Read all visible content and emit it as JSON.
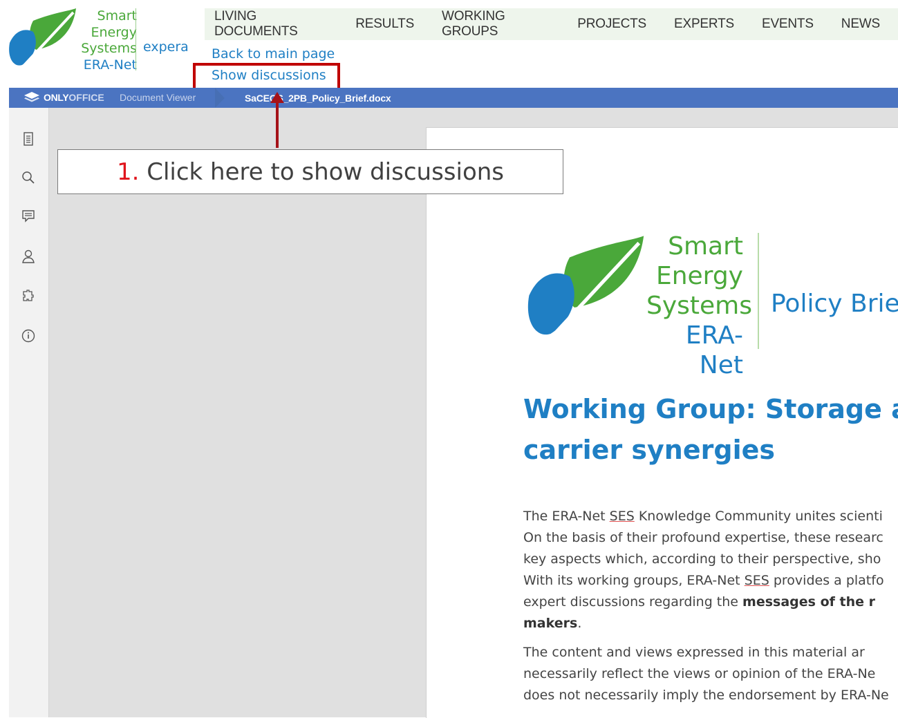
{
  "site": {
    "logo_lines": [
      "Smart",
      "Energy",
      "Systems",
      "ERA-Net"
    ],
    "logo_suffix": "expera"
  },
  "nav": {
    "items": [
      "LIVING DOCUMENTS",
      "RESULTS",
      "WORKING GROUPS",
      "PROJECTS",
      "EXPERTS",
      "EVENTS",
      "NEWS"
    ]
  },
  "links": {
    "back": "Back to main page",
    "show_discussions": "Show discussions"
  },
  "viewer": {
    "brand_only": "ONLY",
    "brand_office": "OFFICE",
    "mode": "Document Viewer",
    "filename": "SaCEGS_2PB_Policy_Brief.docx"
  },
  "toolbar_icons": [
    "document-icon",
    "search-icon",
    "comment-icon",
    "user-icon",
    "plugin-icon",
    "info-icon"
  ],
  "callout": {
    "number": "1.",
    "text": "Click here to show discussions"
  },
  "document": {
    "logo_lines": [
      "Smart",
      "Energy",
      "Systems",
      "ERA-Net"
    ],
    "logo_brief": "Policy Brief",
    "title_line1": "Working Group: Storage a",
    "title_line2": "carrier synergies",
    "para1": {
      "l1a": "The ERA-Net ",
      "l1sp": "SES",
      "l1b": " Knowledge Community unites scienti",
      "l2": "On the basis of their profound expertise, these researc",
      "l3": "key aspects which, according to their perspective, sho",
      "l4a": "With its working groups, ERA-Net ",
      "l4sp": "SES",
      "l4b": " provides a platfo",
      "l5a": "expert discussions regarding the ",
      "l5b": "messages of the r",
      "l6": "makers",
      "l6end": "."
    },
    "para2": {
      "l1": "The content and views expressed in this material ar",
      "l2": "necessarily reflect the views or opinion of the ERA-Ne",
      "l3": "does not necessarily imply the endorsement by ERA-Ne"
    }
  },
  "colors": {
    "brand_blue": "#1f7fc4",
    "brand_green": "#4aa83a",
    "viewer_bar": "#4b74c1",
    "highlight_red": "#c00000"
  }
}
